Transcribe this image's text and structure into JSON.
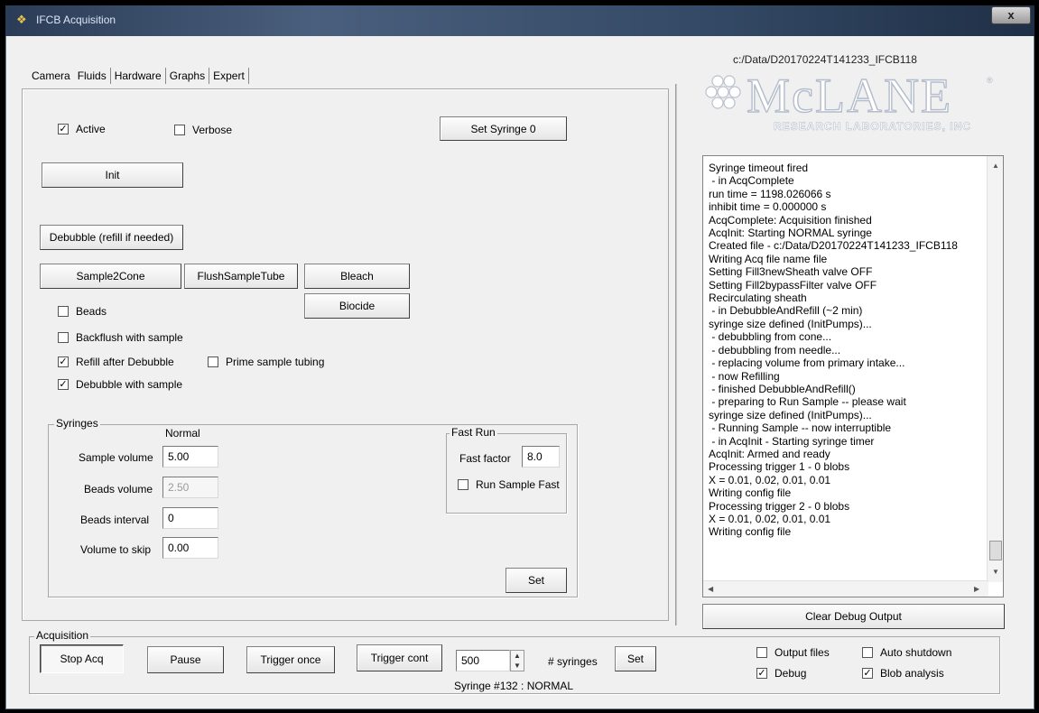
{
  "window": {
    "title": "IFCB Acquisition",
    "close_glyph": "x"
  },
  "tabs": [
    "Camera",
    "Fluids",
    "Hardware",
    "Graphs",
    "Expert"
  ],
  "fluids": {
    "active_label": "Active",
    "active_checked": true,
    "verbose_label": "Verbose",
    "verbose_checked": false,
    "set_syringe0_label": "Set Syringe 0",
    "init_label": "Init",
    "debubble_label": "Debubble (refill if needed)",
    "sample2cone_label": "Sample2Cone",
    "flushsampletube_label": "FlushSampleTube",
    "bleach_label": "Bleach",
    "biocide_label": "Biocide",
    "beads_label": "Beads",
    "beads_checked": false,
    "backflush_label": "Backflush with sample",
    "backflush_checked": false,
    "refill_label": "Refill after Debubble",
    "refill_checked": true,
    "prime_label": "Prime sample tubing",
    "prime_checked": false,
    "debubble_sample_label": "Debubble with sample",
    "debubble_sample_checked": true
  },
  "syringes": {
    "group_title": "Syringes",
    "normal_header": "Normal",
    "sample_volume_label": "Sample volume",
    "sample_volume_value": "5.00",
    "beads_volume_label": "Beads volume",
    "beads_volume_value": "2.50",
    "beads_interval_label": "Beads interval",
    "beads_interval_value": "0",
    "volume_to_skip_label": "Volume to skip",
    "volume_to_skip_value": "0.00",
    "fast_run_title": "Fast Run",
    "fast_factor_label": "Fast factor",
    "fast_factor_value": "8.0",
    "run_sample_fast_label": "Run Sample Fast",
    "run_sample_fast_checked": false,
    "set_label": "Set"
  },
  "acquisition": {
    "group_title": "Acquisition",
    "stop_acq_label": "Stop Acq",
    "pause_label": "Pause",
    "trigger_once_label": "Trigger once",
    "trigger_cont_label": "Trigger cont",
    "syringes_value": "500",
    "syringes_label": "# syringes",
    "set_label": "Set",
    "status": "Syringe #132 : NORMAL"
  },
  "right_panel": {
    "data_path": "c:/Data/D20170224T141233_IFCB118",
    "logo_main": "McLANE",
    "logo_sub": "RESEARCH LABORATORIES, INC",
    "logo_reg": "®",
    "debug_lines": [
      "Syringe timeout fired",
      " - in AcqComplete",
      "run time = 1198.026066 s",
      "inhibit time = 0.000000 s",
      "AcqComplete: Acquisition finished",
      "AcqInit: Starting NORMAL syringe",
      "Created file - c:/Data/D20170224T141233_IFCB118",
      "Writing Acq file name file",
      "Setting Fill3newSheath valve OFF",
      "Setting Fill2bypassFilter valve OFF",
      "Recirculating sheath",
      " - in DebubbleAndRefill (~2 min)",
      "syringe size defined (InitPumps)...",
      " - debubbling from cone...",
      " - debubbling from needle...",
      " - replacing volume from primary intake...",
      " - now Refilling",
      " - finished DebubbleAndRefill()",
      " - preparing to Run Sample -- please wait",
      "syringe size defined (InitPumps)...",
      " - Running Sample -- now interruptible",
      " - in AcqInit - Starting syringe timer",
      "AcqInit: Armed and ready",
      "Processing trigger 1 - 0 blobs",
      "X = 0.01, 0.02, 0.01, 0.01",
      "Writing config file",
      "Processing trigger 2 - 0 blobs",
      "X = 0.01, 0.02, 0.01, 0.01",
      "Writing config file"
    ],
    "clear_debug_label": "Clear Debug Output",
    "output_files_label": "Output files",
    "output_files_checked": false,
    "auto_shutdown_label": "Auto shutdown",
    "auto_shutdown_checked": false,
    "debug_label": "Debug",
    "debug_checked": true,
    "blob_analysis_label": "Blob analysis",
    "blob_analysis_checked": true
  }
}
